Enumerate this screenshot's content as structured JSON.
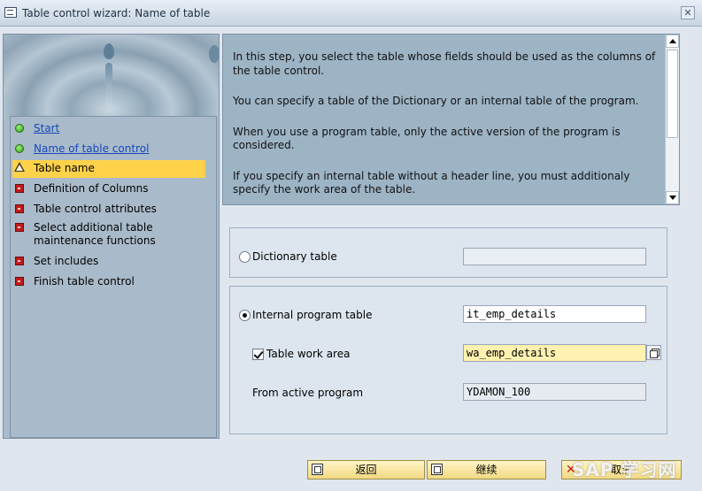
{
  "window": {
    "title": "Table control wizard: Name of table",
    "close_glyph": "✕"
  },
  "steps": [
    {
      "label": "Start",
      "status": "done"
    },
    {
      "label": "Name of table control",
      "status": "done"
    },
    {
      "label": "Table name",
      "status": "current"
    },
    {
      "label": "Definition of Columns",
      "status": "todo"
    },
    {
      "label": "Table control attributes",
      "status": "todo"
    },
    {
      "label": "Select additional table maintenance functions",
      "status": "todo"
    },
    {
      "label": "Set includes",
      "status": "todo"
    },
    {
      "label": "Finish table control",
      "status": "todo"
    }
  ],
  "info": {
    "paragraphs": [
      "In this step, you select the table whose fields should be used as the columns of the table control.",
      "You can specify a table of the Dictionary or an internal table of the program.",
      "When you use a program table, only the active version of the program is considered.",
      "If you specify an internal table without a header line, you must additionaly specify the work area of the table."
    ]
  },
  "form": {
    "dictionary_table": {
      "label": "Dictionary table",
      "selected": false,
      "value": ""
    },
    "internal_table": {
      "label": "Internal program table",
      "selected": true,
      "value": "it_emp_details"
    },
    "work_area": {
      "label": "Table work area",
      "checked": true,
      "value": "wa_emp_details"
    },
    "active_program": {
      "label": "From active program",
      "value": "YDAMON_100"
    }
  },
  "buttons": {
    "back": "返回",
    "continue": "继续",
    "cancel": "取消"
  },
  "watermark": "SAP 学习网"
}
